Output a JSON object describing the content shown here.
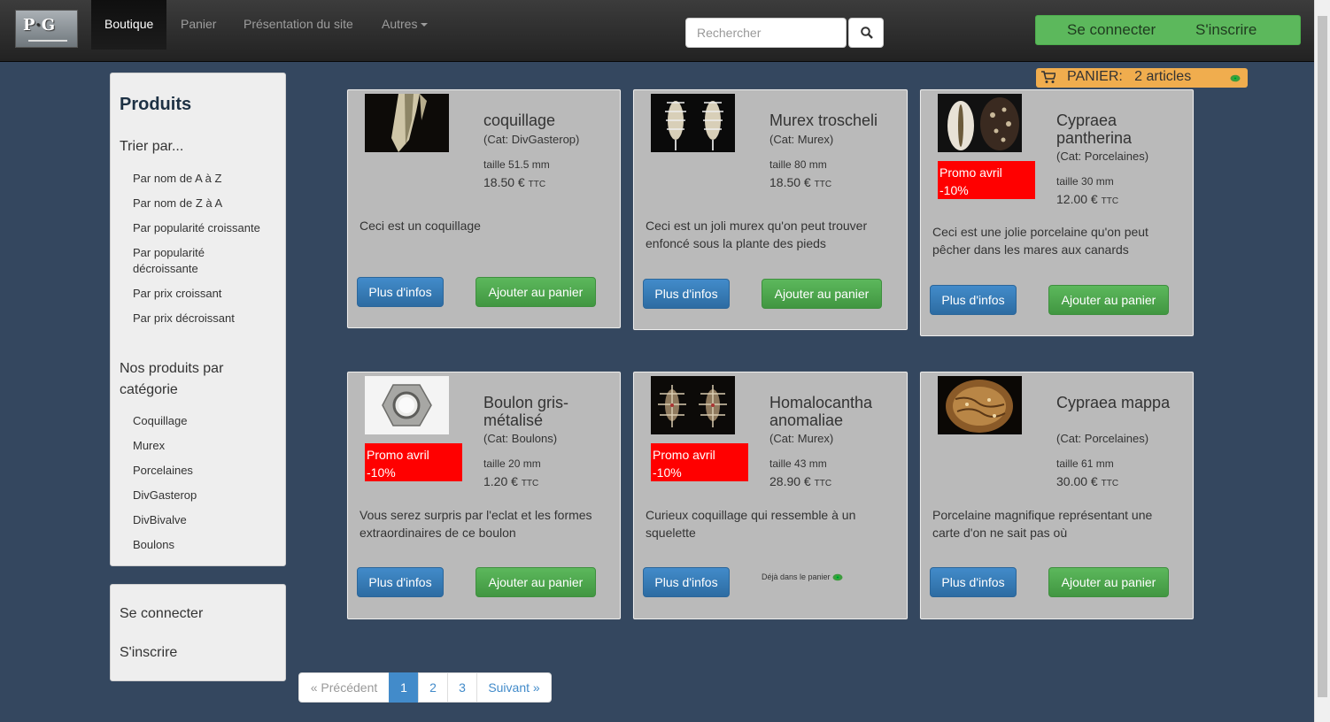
{
  "navbar": {
    "logo_text_a": "P",
    "logo_text_b": "G",
    "items": [
      {
        "label": "Boutique"
      },
      {
        "label": "Panier"
      },
      {
        "label": "Présentation du site"
      },
      {
        "label": "Autres"
      }
    ],
    "search_placeholder": "Rechercher",
    "login_label": "Se connecter",
    "signup_label": "S'inscrire"
  },
  "cart": {
    "label": "PANIER:",
    "count": "2 articles"
  },
  "sidebar": {
    "title": "Produits",
    "sort_heading": "Trier par...",
    "sort_options": [
      {
        "label": "Par nom de A à Z"
      },
      {
        "label": "Par nom de Z à A"
      },
      {
        "label": "Par popularité croissante"
      },
      {
        "label": "Par popularité décroissante"
      },
      {
        "label": "Par prix croissant"
      },
      {
        "label": "Par prix décroissant"
      }
    ],
    "category_heading": "Nos produits par catégorie",
    "categories": [
      {
        "label": "Coquillage"
      },
      {
        "label": "Murex"
      },
      {
        "label": "Porcelaines"
      },
      {
        "label": "DivGasterop"
      },
      {
        "label": "DivBivalve"
      },
      {
        "label": "Boulons"
      }
    ],
    "login_label": "Se connecter",
    "signup_label": "S'inscrire"
  },
  "products": [
    {
      "name": "coquillage",
      "category": "(Cat: DivGasterop)",
      "promo": "",
      "size": "taille 51.5 mm",
      "price": "18.50 €",
      "ttc": "TTC",
      "description": "Ceci est un coquillage",
      "info_label": "Plus d'infos",
      "add_label": "Ajouter au panier"
    },
    {
      "name": "Murex troscheli",
      "category": "(Cat: Murex)",
      "promo": "",
      "size": "taille 80 mm",
      "price": "18.50 €",
      "ttc": "TTC",
      "description": "Ceci est un joli murex qu'on peut trouver enfoncé sous la plante des pieds",
      "info_label": "Plus d'infos",
      "add_label": "Ajouter au panier"
    },
    {
      "name": "Cypraea pantherina",
      "category": "(Cat: Porcelaines)",
      "promo": "Promo avril -10%",
      "size": "taille 30 mm",
      "price": "12.00 €",
      "ttc": "TTC",
      "description": "Ceci est une jolie porcelaine qu'on peut pêcher dans les mares aux canards",
      "info_label": "Plus d'infos",
      "add_label": "Ajouter au panier"
    },
    {
      "name": "Boulon gris-métalisé",
      "category": "(Cat: Boulons)",
      "promo": "Promo avril -10%",
      "size": "taille 20 mm",
      "price": "1.20 €",
      "ttc": "TTC",
      "description": "Vous serez surpris par l'eclat et les formes extraordinaires de ce boulon",
      "info_label": "Plus d'infos",
      "add_label": "Ajouter au panier"
    },
    {
      "name": "Homalocantha anomaliae",
      "category": "(Cat: Murex)",
      "promo": "Promo avril -10%",
      "size": "taille 43 mm",
      "price": "28.90 €",
      "ttc": "TTC",
      "description": "Curieux coquillage qui ressemble à un squelette",
      "info_label": "Plus d'infos",
      "already_label": "Déjà dans le panier"
    },
    {
      "name": "Cypraea mappa",
      "category": "(Cat: Porcelaines)",
      "promo": "",
      "size": "taille 61 mm",
      "price": "30.00 €",
      "ttc": "TTC",
      "description": "Porcelaine magnifique représentant une carte d'on ne sait pas où",
      "info_label": "Plus d'infos",
      "add_label": "Ajouter au panier"
    }
  ],
  "pagination": {
    "prev_label": "« Précédent",
    "pages": [
      "1",
      "2",
      "3"
    ],
    "next_label": "Suivant »"
  },
  "colors": {
    "navbar": "#222222",
    "background": "#34475f",
    "card": "#bababa",
    "promo": "#ff0000",
    "primary": "#428bca",
    "success": "#5cb85c",
    "cart": "#f0ad4e"
  }
}
